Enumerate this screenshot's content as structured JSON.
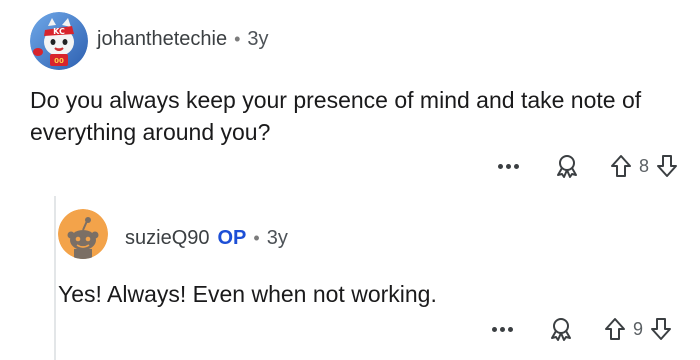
{
  "comments": [
    {
      "username": "johanthetechie",
      "separator": "•",
      "time": "3y",
      "text": "Do you always keep your presence of mind and take note of everything around you?",
      "votes": "8",
      "icons": {
        "more": "more-options-icon",
        "award": "award-icon",
        "upvote": "upvote-arrow-icon",
        "downvote": "downvote-arrow-icon"
      }
    },
    {
      "username": "suzieQ90",
      "badge": "OP",
      "separator": "•",
      "time": "3y",
      "text": "Yes! Always! Even when not working.",
      "votes": "9",
      "avatar_color": "#f3a34a",
      "icons": {
        "more": "more-options-icon",
        "award": "award-icon",
        "upvote": "upvote-arrow-icon",
        "downvote": "downvote-arrow-icon"
      }
    }
  ],
  "colors": {
    "op_badge": "#1d4fd6",
    "thread_line": "#e3e6e8",
    "text": "#1a1a1b"
  }
}
